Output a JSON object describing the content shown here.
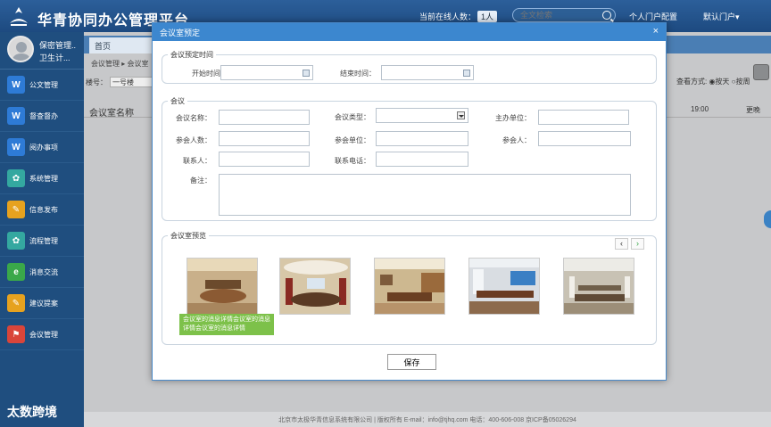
{
  "header": {
    "app_title": "华青协同办公管理平台",
    "online_label": "当前在线人数：",
    "online_count": "1人",
    "search_placeholder": "全文检索",
    "portal_config": "个人门户配置",
    "default_portal": "默认门户▾"
  },
  "user": {
    "name": "保密管理..",
    "unit": "卫生计..."
  },
  "sidebar": {
    "items": [
      {
        "label": "公文管理",
        "color": "#2e7bd6",
        "glyph": "W"
      },
      {
        "label": "督查督办",
        "color": "#2e7bd6",
        "glyph": "W"
      },
      {
        "label": "阅办事项",
        "color": "#2e7bd6",
        "glyph": "W"
      },
      {
        "label": "系统管理",
        "color": "#34a8a0",
        "glyph": "✿"
      },
      {
        "label": "信息发布",
        "color": "#e6a21f",
        "glyph": "✎"
      },
      {
        "label": "流程管理",
        "color": "#34a8a0",
        "glyph": "✿"
      },
      {
        "label": "消息交流",
        "color": "#3aa84a",
        "glyph": "e"
      },
      {
        "label": "建议提案",
        "color": "#e6a21f",
        "glyph": "✎"
      },
      {
        "label": "会议管理",
        "color": "#d9453a",
        "glyph": "⚑"
      }
    ]
  },
  "main": {
    "tab_home": "首页",
    "breadcrumb": "会议管理 ▸ 会议室",
    "room_no_label": "楼号：",
    "room_no_value": "一号楼",
    "view_mode": "查看方式: ◉按天 ○按周",
    "col_room": "会议室名称",
    "col_time": "19:00",
    "col_more": "更晚"
  },
  "modal": {
    "title": "会议室预定",
    "close": "×",
    "time_group": {
      "legend": "会议预定时间",
      "start_label": "开始时间：",
      "start_value": "",
      "end_label": "结束时间：",
      "end_value": ""
    },
    "meeting_group": {
      "legend": "会议",
      "name_label": "会议名称：",
      "type_label": "会议类型：",
      "host_label": "主办单位：",
      "count_label": "参会人数：",
      "units_label": "参会单位：",
      "people_label": "参会人：",
      "contact_label": "联系人：",
      "phone_label": "联系电话：",
      "remark_label": "备注："
    },
    "preview_group": {
      "legend": "会议室预览",
      "prev": "‹",
      "next": "›",
      "caption": "会议室的消息详情会议室的消息详情会议室的消息详情"
    },
    "save_label": "保存"
  },
  "footer": {
    "text": "北京市太极华青信息系统有限公司 | 版权所有 E-mail：info@tjhq.com 电话：400-606-008 京ICP备05026294"
  },
  "watermark": "太数跨境"
}
